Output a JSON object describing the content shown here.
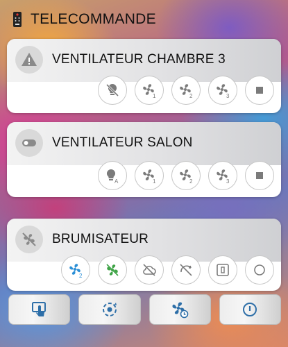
{
  "header": {
    "title": "TELECOMMANDE",
    "icon": "remote-control-icon"
  },
  "colors": {
    "icon_gray": "#7b7b7b",
    "icon_blue": "#2e6fa8",
    "fan_blue": "#2b8fd6",
    "fan_green": "#3fa447"
  },
  "cards": [
    {
      "title": "VENTILATEUR CHAMBRE 3",
      "icon": "warning-icon",
      "buttons": [
        {
          "name": "light-off-button",
          "icon": "bulb-off-icon"
        },
        {
          "name": "fan-speed-1-button",
          "icon": "fan-speed-1-icon",
          "speed": "1"
        },
        {
          "name": "fan-speed-2-button",
          "icon": "fan-speed-2-icon",
          "speed": "2"
        },
        {
          "name": "fan-speed-3-button",
          "icon": "fan-speed-3-icon",
          "speed": "3"
        },
        {
          "name": "stop-button",
          "icon": "stop-icon"
        }
      ]
    },
    {
      "title": "VENTILATEUR SALON",
      "icon": "toggle-icon",
      "buttons": [
        {
          "name": "light-auto-button",
          "icon": "bulb-auto-icon",
          "label": "A"
        },
        {
          "name": "fan-speed-1-button",
          "icon": "fan-speed-1-icon",
          "speed": "1"
        },
        {
          "name": "fan-speed-2-button",
          "icon": "fan-speed-2-icon",
          "speed": "2"
        },
        {
          "name": "fan-speed-3-button",
          "icon": "fan-speed-3-icon",
          "speed": "3"
        },
        {
          "name": "stop-button",
          "icon": "stop-icon"
        }
      ]
    },
    {
      "title": "BRUMISATEUR",
      "icon": "fan-off-icon",
      "buttons": [
        {
          "name": "fan-speed-2-button",
          "icon": "fan-speed-2-blue-icon",
          "speed": "2"
        },
        {
          "name": "fan-auto-button",
          "icon": "fan-auto-green-icon"
        },
        {
          "name": "mist-off-button",
          "icon": "cloud-off-icon"
        },
        {
          "name": "swing-off-button",
          "icon": "swing-off-icon"
        },
        {
          "name": "timer-button",
          "icon": "timer-square-icon"
        },
        {
          "name": "power-toggle-button",
          "icon": "circle-icon"
        }
      ],
      "actions": [
        {
          "name": "touch-button",
          "icon": "touch-screen-icon"
        },
        {
          "name": "mode-cycle-button",
          "icon": "cycle-icon"
        },
        {
          "name": "fan-timer-button",
          "icon": "fan-clock-icon"
        },
        {
          "name": "power-button",
          "icon": "power-icon"
        }
      ]
    }
  ]
}
